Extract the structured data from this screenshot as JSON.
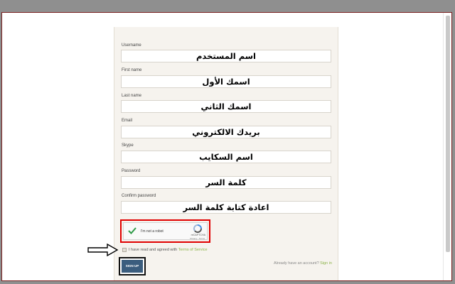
{
  "form": {
    "fields": [
      {
        "label": "Username",
        "value": "اسم المستخدم"
      },
      {
        "label": "First name",
        "value": "اسمك الأول"
      },
      {
        "label": "Last name",
        "value": "اسمك الثاني"
      },
      {
        "label": "Email",
        "value": "بريدك الالكتروني"
      },
      {
        "label": "Skype",
        "value": "اسم السكايب"
      },
      {
        "label": "Password",
        "value": "كلمة السر"
      },
      {
        "label": "Confirm password",
        "value": "اعادة كتابة كلمة السر"
      }
    ],
    "captcha": {
      "text": "I'm not a robot",
      "brand": "reCAPTCHA",
      "terms": "Privacy - Terms",
      "checked": true
    },
    "agree": {
      "text": "I have read and agreed with",
      "link": "Terms of Service",
      "checked": true
    },
    "signup_label": "SIGN UP",
    "already_text": "Already have an account?",
    "signin_link": "Sign in"
  },
  "colors": {
    "captcha_highlight": "#e00000",
    "button": "#3b5d7e",
    "link": "#8cb34a",
    "checkmark": "#2e9a47"
  }
}
